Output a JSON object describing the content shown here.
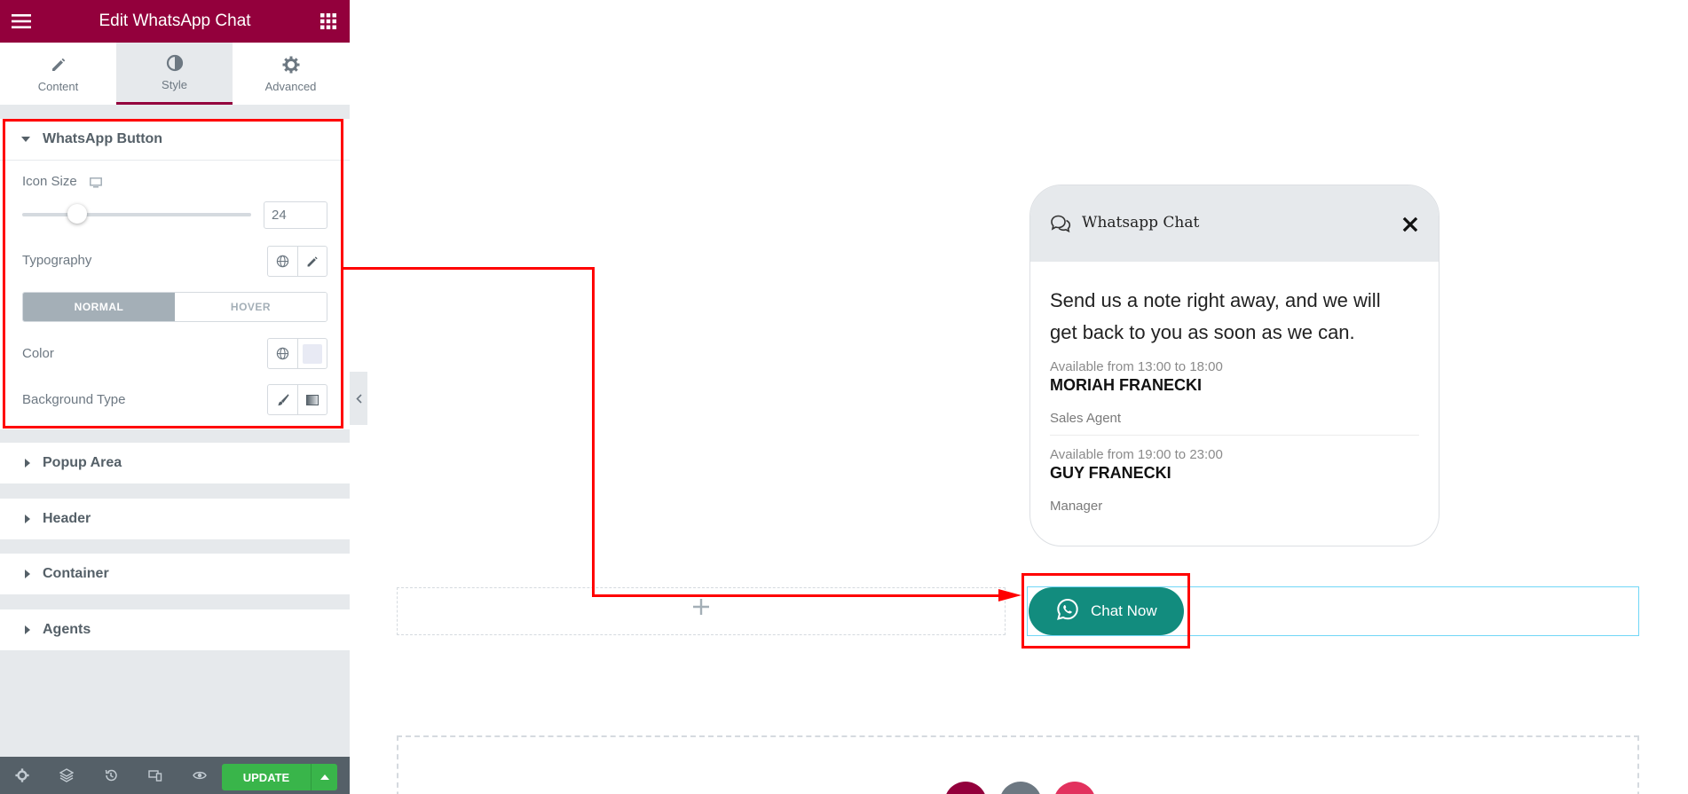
{
  "panel": {
    "title": "Edit WhatsApp Chat",
    "tabs": [
      {
        "label": "Content",
        "icon": "pencil-icon"
      },
      {
        "label": "Style",
        "icon": "half-circle-icon"
      },
      {
        "label": "Advanced",
        "icon": "gear-icon"
      }
    ],
    "active_tab": "Style",
    "whatsapp_section": {
      "title": "WhatsApp Button",
      "icon_size_label": "Icon Size",
      "icon_size_value": "24",
      "typography_label": "Typography",
      "state_tabs": [
        "NORMAL",
        "HOVER"
      ],
      "color_label": "Color",
      "bg_type_label": "Background Type"
    },
    "collapsed_sections": [
      "Popup Area",
      "Header",
      "Container",
      "Agents"
    ],
    "update_label": "UPDATE"
  },
  "popup": {
    "title": "Whatsapp Chat",
    "message": "Send us a note right away, and we will get back to you as soon as we can.",
    "agents": [
      {
        "availability": "Available from 13:00 to 18:00",
        "name": "MORIAH FRANECKI",
        "role": "Sales Agent"
      },
      {
        "availability": "Available from 19:00 to 23:00",
        "name": "GUY FRANECKI",
        "role": "Manager"
      }
    ]
  },
  "chat_button": {
    "label": "Chat Now"
  },
  "colors": {
    "brand": "#93003c",
    "whatsapp_green": "#128c7e",
    "update_green": "#39b54a",
    "annotation_red": "#ff0000"
  }
}
